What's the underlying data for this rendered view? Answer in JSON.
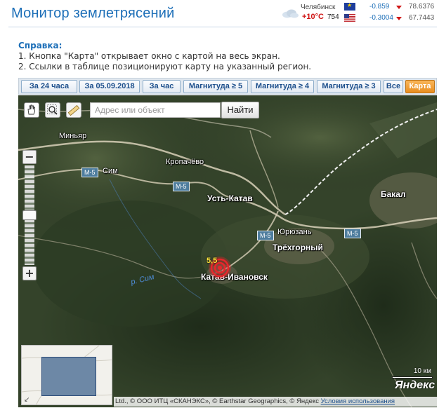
{
  "page": {
    "title": "Монитор землетрясений"
  },
  "weather": {
    "city": "Челябинск",
    "temperature": "+10°C",
    "pressure": "754",
    "icon": "cloudy-icon"
  },
  "rates": [
    {
      "currency": "EUR",
      "flag": "eu-flag-icon",
      "change": "-0.859",
      "trend": "down",
      "value": "78.6376"
    },
    {
      "currency": "USD",
      "flag": "us-flag-icon",
      "change": "-0.3004",
      "trend": "down",
      "value": "67.7443"
    }
  ],
  "help": {
    "heading": "Справка:",
    "lines": [
      "1. Кнопка \"Карта\" открывает окно с картой на весь экран.",
      "2. Ссылки в таблице позиционируют карту на указанный регион."
    ]
  },
  "toolbar": {
    "buttons": [
      "За 24 часа",
      "За 05.09.2018",
      "За час",
      "Магнитуда ≥ 5",
      "Магнитуда ≥ 4",
      "Магнитуда ≥ 3",
      "Все",
      "Карта"
    ]
  },
  "map": {
    "search_placeholder": "Адрес или объект",
    "find_button": "Найти",
    "places": [
      "Миньяр",
      "Сим",
      "Кропачёво",
      "Усть-Катав",
      "Бакал",
      "Юрюзань",
      "Трёхгорный",
      "Катав-Ивановск"
    ],
    "river": "р. Сим",
    "road_shields": [
      "М-5",
      "М-5",
      "М-5",
      "М-5"
    ],
    "earthquake_magnitude": "5,5",
    "scale": "10 км",
    "logo": "Яндекс",
    "attribution": "Ltd., © ООО ИТЦ «СКАНЭКС», © Earthstar Geographics, © Яндекс",
    "terms_link": "Условия использования"
  },
  "colors": {
    "title": "#1d6fb8",
    "accent_orange": "#e98d1f",
    "quake_red": "#e8262b"
  }
}
